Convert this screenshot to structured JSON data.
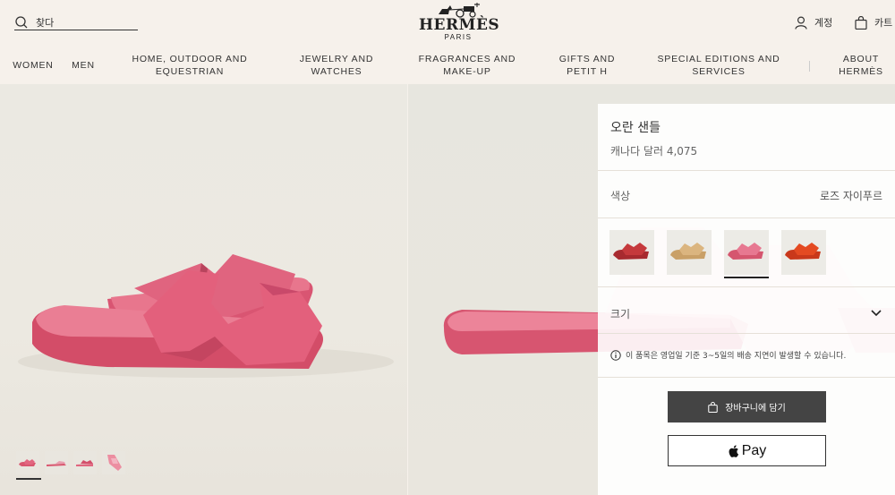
{
  "header": {
    "search_label": "찾다",
    "brand_name": "HERMÈS",
    "brand_city": "PARIS",
    "account_label": "계정",
    "cart_label": "카트"
  },
  "nav": {
    "items": [
      {
        "label": "WOMEN"
      },
      {
        "label": "MEN"
      },
      {
        "label": "HOME, OUTDOOR AND\nEQUESTRIAN"
      },
      {
        "label": "JEWELRY AND\nWATCHES"
      },
      {
        "label": "FRAGRANCES AND\nMAKE-UP"
      },
      {
        "label": "GIFTS AND\nPETIT H"
      },
      {
        "label": "SPECIAL EDITIONS AND\nSERVICES"
      },
      {
        "label": "ABOUT\nHERMÈS"
      }
    ]
  },
  "gallery": {
    "thumbnail_count": 4,
    "active_thumbnail": 1
  },
  "product": {
    "title": "오란 샌들",
    "price": "캐나다 달러 4,075",
    "color_label": "색상",
    "color_value": "로즈 자이푸르",
    "swatches": [
      {
        "name": "red-sandal-swatch",
        "color": "#c23a3c"
      },
      {
        "name": "tan-sandal-swatch",
        "color": "#d7b07a"
      },
      {
        "name": "pink-sandal-swatch",
        "color": "#e06a86"
      },
      {
        "name": "orange-sandal-swatch",
        "color": "#e0431f"
      }
    ],
    "active_swatch": 3,
    "size_label": "크기",
    "notice": "이 품목은 영업일 기준 3~5일의 배송 지연이 발생할 수 있습니다.",
    "add_to_bag": "장바구니에 담기",
    "apple_pay": "Pay"
  },
  "colors": {
    "background": "#f6f1eb",
    "sandal_pink": "#e0566f",
    "button_dark": "#444444"
  }
}
